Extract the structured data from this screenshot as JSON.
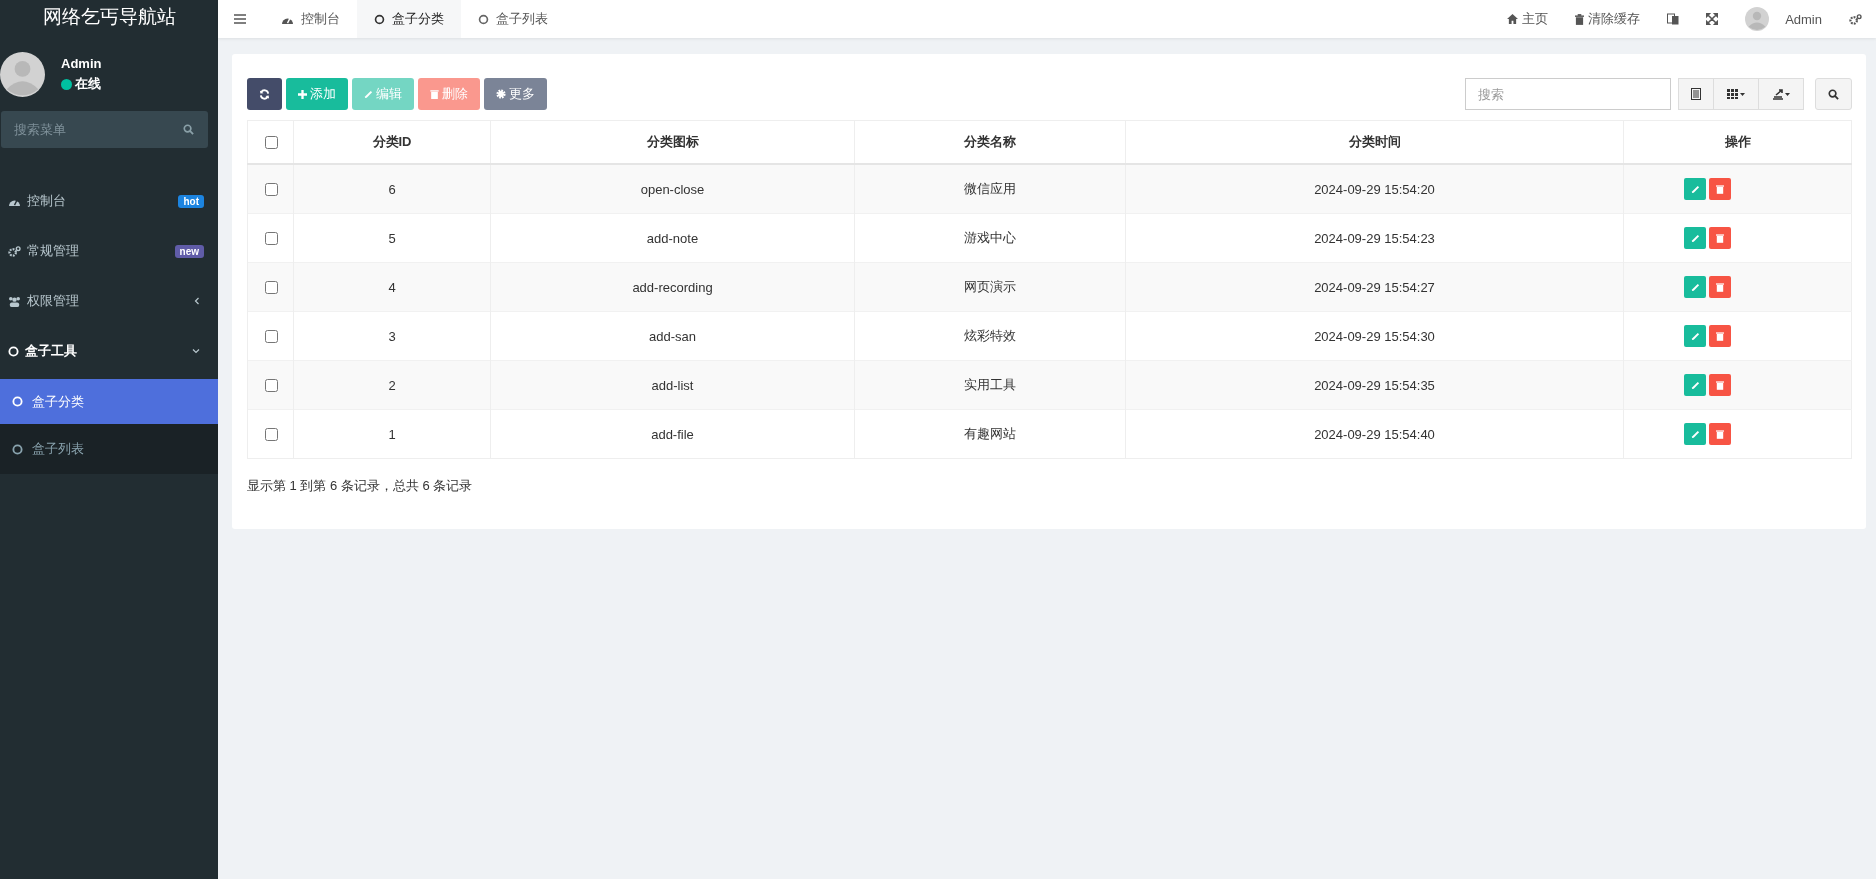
{
  "sidebar": {
    "title": "网络乞丐导航站",
    "user": {
      "name": "Admin",
      "status": "在线"
    },
    "search": {
      "placeholder": "搜索菜单"
    },
    "menu": [
      {
        "label": "控制台",
        "selected": false,
        "badge": {
          "text": "hot",
          "color": "#1c84e0"
        }
      },
      {
        "label": "常规管理",
        "selected": false,
        "badge": {
          "text": "new",
          "color": "#605ca8"
        }
      },
      {
        "label": "权限管理",
        "selected": false,
        "expanded": false
      },
      {
        "label": "盒子工具",
        "selected": true,
        "expanded": true,
        "children": [
          {
            "label": "盒子分类",
            "selected": true
          },
          {
            "label": "盒子列表",
            "selected": false
          }
        ]
      }
    ]
  },
  "tabs": [
    {
      "label": "控制台",
      "selected": false
    },
    {
      "label": "盒子分类",
      "selected": true
    },
    {
      "label": "盒子列表",
      "selected": false
    }
  ],
  "top_nav": {
    "home": "主页",
    "clear_cache": "清除缓存",
    "user": "Admin"
  },
  "toolbar": {
    "buttons": [
      {
        "kind": "refresh",
        "disabled": false
      },
      {
        "kind": "add",
        "label": "添加",
        "disabled": false
      },
      {
        "kind": "edit",
        "label": "编辑",
        "disabled": true
      },
      {
        "kind": "delete",
        "label": "删除",
        "disabled": true
      },
      {
        "kind": "more",
        "label": "更多",
        "disabled": false
      }
    ],
    "search": {
      "placeholder": "搜索"
    }
  },
  "table": {
    "columns": [
      "分类ID",
      "分类图标",
      "分类名称",
      "分类时间",
      "操作"
    ],
    "rows": [
      {
        "checked": false,
        "cells": [
          "6",
          "open-close",
          "微信应用",
          "2024-09-29 15:54:20"
        ]
      },
      {
        "checked": false,
        "cells": [
          "5",
          "add-note",
          "游戏中心",
          "2024-09-29 15:54:23"
        ]
      },
      {
        "checked": false,
        "cells": [
          "4",
          "add-recording",
          "网页演示",
          "2024-09-29 15:54:27"
        ]
      },
      {
        "checked": false,
        "cells": [
          "3",
          "add-san",
          "炫彩特效",
          "2024-09-29 15:54:30"
        ]
      },
      {
        "checked": false,
        "cells": [
          "2",
          "add-list",
          "实用工具",
          "2024-09-29 15:54:35"
        ]
      },
      {
        "checked": false,
        "cells": [
          "1",
          "add-file",
          "有趣网站",
          "2024-09-29 15:54:40"
        ]
      }
    ],
    "header_checked": false
  },
  "pagination": {
    "summary": "显示第 1 到第 6 条记录，总共 6 条记录"
  }
}
